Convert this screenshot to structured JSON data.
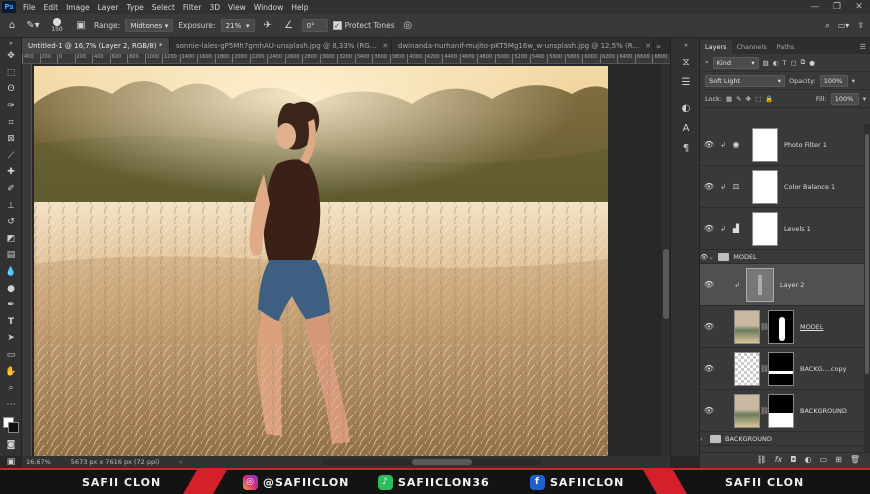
{
  "menu": {
    "logo": "Ps",
    "items": [
      "File",
      "Edit",
      "Image",
      "Layer",
      "Type",
      "Select",
      "Filter",
      "3D",
      "View",
      "Window",
      "Help"
    ],
    "window_controls": [
      "—",
      "❐",
      "✕"
    ]
  },
  "options": {
    "brush_size": "150",
    "range_label": "Range:",
    "range_value": "Midtones",
    "exposure_label": "Exposure:",
    "exposure_value": "21%",
    "angle_value": "0°",
    "protect_tones_label": "Protect Tones"
  },
  "tabs": [
    {
      "label": "Untitled-1 @ 16,7% (Layer 2, RGB/8) *",
      "active": true
    },
    {
      "label": "sonnie-lales-gP5Mh7gmhAU-unsplash.jpg @ 8,33% (RG...",
      "active": false
    },
    {
      "label": "dwinanda-nurhanif-mujito-pKT5Mg16w_w-unsplash.jpg @ 12,5% (R...",
      "active": false
    }
  ],
  "ruler_ticks": [
    "400",
    "200",
    "0",
    "200",
    "400",
    "600",
    "800",
    "1000",
    "1200",
    "1400",
    "1600",
    "1800",
    "2000",
    "2200",
    "2400",
    "2600",
    "2800",
    "3000",
    "3200",
    "3400",
    "3600",
    "3800",
    "4000",
    "4200",
    "4400",
    "4600",
    "4800",
    "5000",
    "5200",
    "5400",
    "5600",
    "5800",
    "6000",
    "6200",
    "6400",
    "6600",
    "6800"
  ],
  "status": {
    "zoom": "16,67%",
    "doc_size": "5673 px x 7616 px (72 ppi)"
  },
  "layers_panel": {
    "tabs": [
      "Layers",
      "Channels",
      "Paths"
    ],
    "filter_value": "Kind",
    "blend_mode": "Soft Light",
    "opacity_label": "Opacity:",
    "opacity_value": "100%",
    "lock_label": "Lock:",
    "fill_label": "Fill:",
    "fill_value": "100%",
    "layers": [
      {
        "name": "Photo Filter 1"
      },
      {
        "name": "Color Balance 1"
      },
      {
        "name": "Levels 1"
      },
      {
        "name": "MODEL",
        "group": true
      },
      {
        "name": "Layer 2",
        "selected": true
      },
      {
        "name": "MODEL"
      },
      {
        "name": "BACKG....copy"
      },
      {
        "name": "BACKGROUND"
      },
      {
        "name": "BACKGROUND",
        "group": true
      }
    ]
  },
  "banner": {
    "left_name": "SAFII CLON",
    "instagram": "@SAFIICLON",
    "tiktok": "SAFIICLON36",
    "facebook": "SAFIICLON",
    "right_name": "SAFII CLON"
  }
}
